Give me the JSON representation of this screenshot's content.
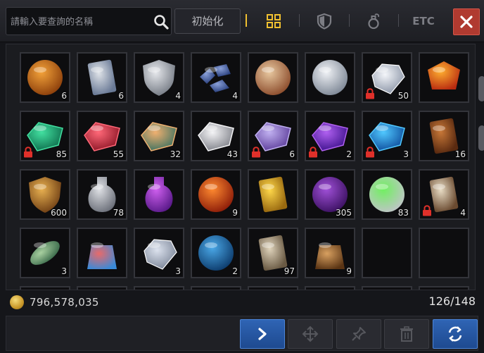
{
  "header": {
    "search_placeholder": "請輸入要查詢的名稱",
    "reset_label": "初始化",
    "filter_etc_label": "ETC",
    "filters": [
      "all-filter-icon",
      "equipment-filter-icon",
      "potion-filter-icon"
    ]
  },
  "accent_color": "#f0c030",
  "items": [
    {
      "name": "gold-emblem-icon",
      "qty": "6",
      "locked": false,
      "colors": [
        "#f3a23a",
        "#8a3d0a"
      ]
    },
    {
      "name": "scroll-map-icon",
      "qty": "6",
      "locked": false,
      "colors": [
        "#dfe3e8",
        "#6a7a96"
      ]
    },
    {
      "name": "silver-crest-icon",
      "qty": "4",
      "locked": false,
      "colors": [
        "#e6e8ec",
        "#707680"
      ]
    },
    {
      "name": "ore-fragments-icon",
      "qty": "4",
      "locked": false,
      "colors": [
        "#8aa0d8",
        "#243a78"
      ]
    },
    {
      "name": "star-medal-icon",
      "qty": "",
      "locked": false,
      "colors": [
        "#e8c8a0",
        "#8a4a2a"
      ]
    },
    {
      "name": "silver-coin-icon",
      "qty": "",
      "locked": false,
      "colors": [
        "#f0f2f6",
        "#7c8694"
      ]
    },
    {
      "name": "diamond-icon",
      "qty": "50",
      "locked": true,
      "colors": [
        "#f4f6fa",
        "#8892a4"
      ]
    },
    {
      "name": "orange-gem-icon",
      "qty": "",
      "locked": false,
      "colors": [
        "#ffb030",
        "#b82a10"
      ]
    },
    {
      "name": "green-stone-icon",
      "qty": "85",
      "locked": true,
      "colors": [
        "#42e0a0",
        "#0c6a4a"
      ]
    },
    {
      "name": "red-stone-icon",
      "qty": "55",
      "locked": false,
      "colors": [
        "#ff6878",
        "#8a1424"
      ]
    },
    {
      "name": "amber-stone-icon",
      "qty": "32",
      "locked": false,
      "colors": [
        "#f0b070",
        "#3a7060"
      ]
    },
    {
      "name": "white-stone-icon",
      "qty": "43",
      "locked": false,
      "colors": [
        "#f4f4f6",
        "#7c7e86"
      ]
    },
    {
      "name": "violet-stone-icon",
      "qty": "6",
      "locked": true,
      "colors": [
        "#c0b0f0",
        "#5a3a98"
      ]
    },
    {
      "name": "purple-stone-icon",
      "qty": "2",
      "locked": true,
      "colors": [
        "#b060f0",
        "#3a108a"
      ]
    },
    {
      "name": "blue-stone-icon",
      "qty": "3",
      "locked": true,
      "colors": [
        "#50c8ff",
        "#0c4a9a"
      ]
    },
    {
      "name": "book-icon",
      "qty": "16",
      "locked": false,
      "colors": [
        "#c87838",
        "#5a2a10"
      ]
    },
    {
      "name": "lion-shield-icon",
      "qty": "600",
      "locked": false,
      "colors": [
        "#e8b050",
        "#6a3a12"
      ]
    },
    {
      "name": "empty-bottle-icon",
      "qty": "78",
      "locked": false,
      "colors": [
        "#e0e2e6",
        "#6c707a"
      ]
    },
    {
      "name": "purple-potion-icon",
      "qty": "",
      "locked": false,
      "colors": [
        "#d060f0",
        "#5a1a8a"
      ]
    },
    {
      "name": "fire-skull-orb-icon",
      "qty": "9",
      "locked": false,
      "colors": [
        "#ff8a30",
        "#8a1a08"
      ]
    },
    {
      "name": "gold-scroll-icon",
      "qty": "",
      "locked": false,
      "colors": [
        "#ffd84a",
        "#9a6a10"
      ]
    },
    {
      "name": "purple-rune-icon",
      "qty": "305",
      "locked": false,
      "colors": [
        "#a050d8",
        "#3a1060"
      ]
    },
    {
      "name": "green-orb-icon",
      "qty": "83",
      "locked": false,
      "colors": [
        "#70f060",
        "#c0c4c8"
      ]
    },
    {
      "name": "shield-scroll-icon",
      "qty": "4",
      "locked": true,
      "colors": [
        "#e8dcc4",
        "#6a4a30"
      ]
    },
    {
      "name": "fish-icon",
      "qty": "3",
      "locked": false,
      "colors": [
        "#a8d0a0",
        "#3a6a4a"
      ]
    },
    {
      "name": "striped-bag-icon",
      "qty": "",
      "locked": false,
      "colors": [
        "#e86a6a",
        "#3a8ad8"
      ]
    },
    {
      "name": "crystal-icon",
      "qty": "3",
      "locked": false,
      "colors": [
        "#dce2ee",
        "#7a8496"
      ]
    },
    {
      "name": "blue-orb-icon",
      "qty": "2",
      "locked": false,
      "colors": [
        "#4aa8e8",
        "#0c3a6a"
      ]
    },
    {
      "name": "rune-scroll-icon",
      "qty": "97",
      "locked": false,
      "colors": [
        "#e0d4bc",
        "#6a5a44"
      ]
    },
    {
      "name": "coin-bag-icon",
      "qty": "9",
      "locked": false,
      "colors": [
        "#d8a060",
        "#5a3414"
      ]
    },
    {
      "name": "empty-slot",
      "qty": "",
      "locked": false,
      "colors": []
    },
    {
      "name": "empty-slot",
      "qty": "",
      "locked": false,
      "colors": []
    },
    {
      "name": "empty-slot",
      "qty": "",
      "locked": false,
      "colors": []
    },
    {
      "name": "empty-slot",
      "qty": "",
      "locked": false,
      "colors": []
    },
    {
      "name": "empty-slot",
      "qty": "",
      "locked": false,
      "colors": []
    },
    {
      "name": "empty-slot",
      "qty": "",
      "locked": false,
      "colors": []
    },
    {
      "name": "empty-slot",
      "qty": "",
      "locked": false,
      "colors": []
    },
    {
      "name": "empty-slot",
      "qty": "",
      "locked": false,
      "colors": []
    },
    {
      "name": "empty-slot",
      "qty": "",
      "locked": false,
      "colors": []
    },
    {
      "name": "empty-slot",
      "qty": "",
      "locked": false,
      "colors": []
    }
  ],
  "footer": {
    "gold_amount": "796,578,035",
    "capacity": "126/148"
  },
  "actions": [
    "next-icon",
    "move-icon",
    "pin-icon",
    "trash-icon",
    "sort-icon"
  ]
}
